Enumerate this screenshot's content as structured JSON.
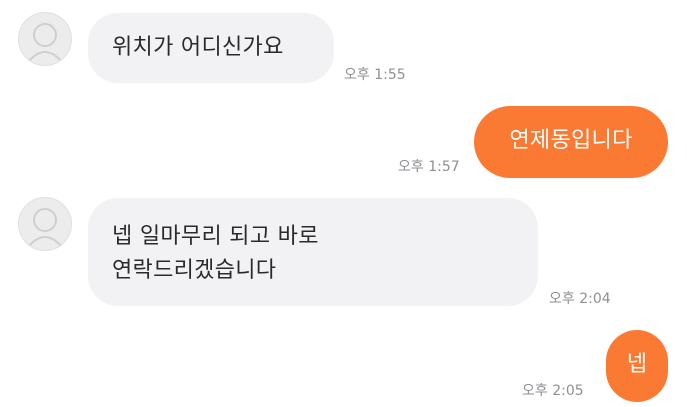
{
  "colors": {
    "incoming_bubble": "#f2f2f5",
    "outgoing_bubble": "#fb7a33",
    "timestamp_text": "#8f8f94"
  },
  "messages": [
    {
      "sender": "other",
      "avatar_icon": "default-profile-icon",
      "text": "위치가 어디신가요",
      "time": "오후 1:55"
    },
    {
      "sender": "me",
      "text": "연제동입니다",
      "time": "오후 1:57"
    },
    {
      "sender": "other",
      "avatar_icon": "default-profile-icon",
      "lines": [
        "넵 일마무리 되고 바로",
        "연락드리겠습니다"
      ],
      "time": "오후 2:04"
    },
    {
      "sender": "me",
      "text": "넵",
      "time": "오후 2:05"
    }
  ]
}
